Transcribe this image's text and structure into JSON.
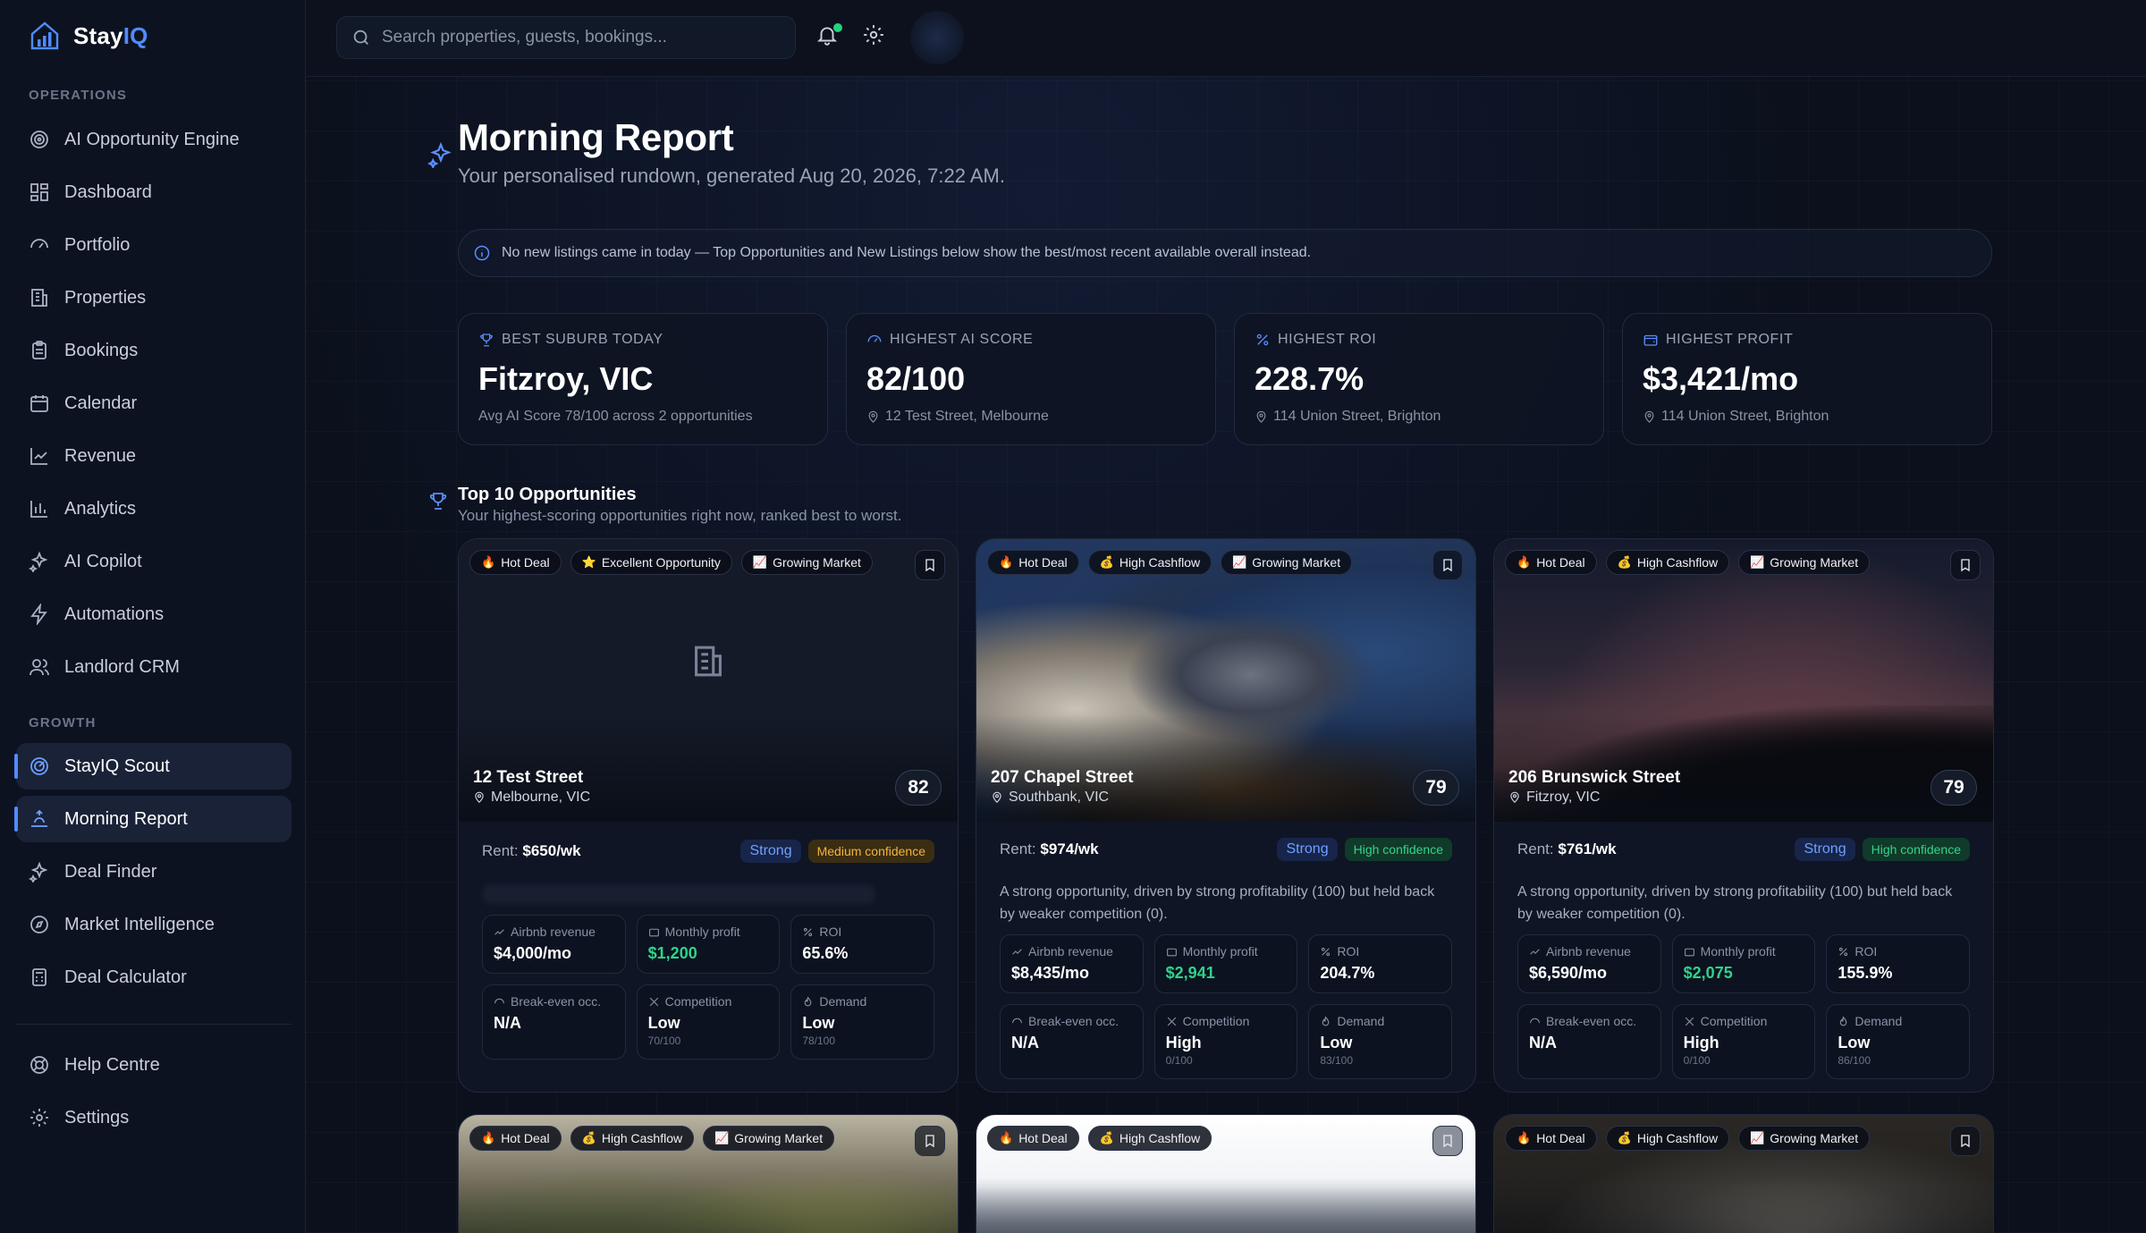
{
  "app": {
    "name_prefix": "Stay",
    "name_suffix": "IQ"
  },
  "sidebar": {
    "operations_label": "OPERATIONS",
    "growth_label": "GROWTH",
    "operations": [
      {
        "label": "AI Opportunity Engine",
        "icon": "target-icon"
      },
      {
        "label": "Dashboard",
        "icon": "grid-icon"
      },
      {
        "label": "Portfolio",
        "icon": "gauge-icon"
      },
      {
        "label": "Properties",
        "icon": "building-icon"
      },
      {
        "label": "Bookings",
        "icon": "clipboard-icon"
      },
      {
        "label": "Calendar",
        "icon": "calendar-icon"
      },
      {
        "label": "Revenue",
        "icon": "trend-icon"
      },
      {
        "label": "Analytics",
        "icon": "bar-chart-icon"
      },
      {
        "label": "AI Copilot",
        "icon": "sparkle-icon"
      },
      {
        "label": "Automations",
        "icon": "bolt-icon"
      },
      {
        "label": "Landlord CRM",
        "icon": "users-icon"
      }
    ],
    "growth": [
      {
        "label": "StayIQ Scout",
        "icon": "scout-icon"
      },
      {
        "label": "Morning Report",
        "icon": "sunrise-icon"
      },
      {
        "label": "Deal Finder",
        "icon": "sparkle-icon"
      },
      {
        "label": "Market Intelligence",
        "icon": "compass-icon"
      },
      {
        "label": "Deal Calculator",
        "icon": "calculator-icon"
      }
    ],
    "footer": [
      {
        "label": "Help Centre",
        "icon": "lifebuoy-icon"
      },
      {
        "label": "Settings",
        "icon": "gear-icon"
      }
    ]
  },
  "topbar": {
    "search_placeholder": "Search properties, guests, bookings..."
  },
  "page": {
    "title": "Morning Report",
    "subtitle": "Your personalised rundown, generated Aug 20, 2026, 7:22 AM.",
    "notice": "No new listings came in today — Top Opportunities and New Listings below show the best/most recent available overall instead."
  },
  "stats": [
    {
      "label": "BEST SUBURB TODAY",
      "value": "Fitzroy, VIC",
      "sub": "Avg AI Score 78/100 across 2 opportunities",
      "icon": "trophy-icon",
      "has_pin": false
    },
    {
      "label": "HIGHEST AI SCORE",
      "value": "82/100",
      "sub": "12 Test Street, Melbourne",
      "icon": "gauge-icon",
      "has_pin": true
    },
    {
      "label": "HIGHEST ROI",
      "value": "228.7%",
      "sub": "114 Union Street, Brighton",
      "icon": "percent-icon",
      "has_pin": true
    },
    {
      "label": "HIGHEST PROFIT",
      "value": "$3,421/mo",
      "sub": "114 Union Street, Brighton",
      "icon": "wallet-icon",
      "has_pin": true
    }
  ],
  "top": {
    "title": "Top 10 Opportunities",
    "subtitle": "Your highest-scoring opportunities right now, ranked best to worst."
  },
  "labels": {
    "rent": "Rent:",
    "airbnb": "Airbnb revenue",
    "profit": "Monthly profit",
    "roi": "ROI",
    "breakeven": "Break-even occ.",
    "competition": "Competition",
    "demand": "Demand"
  },
  "cards": [
    {
      "street": "12 Test Street",
      "city": "Melbourne, VIC",
      "score": "82",
      "chips": [
        "Hot Deal",
        "Excellent Opportunity",
        "Growing Market"
      ],
      "rent": "$650/wk",
      "strength": "Strong",
      "confidence": "Medium confidence",
      "desc": "",
      "airbnb": "$4,000/mo",
      "profit": "$1,200",
      "roi": "65.6%",
      "breakeven": "N/A",
      "competition": "Low",
      "competition_score": "70/100",
      "demand": "Low",
      "demand_score": "78/100"
    },
    {
      "street": "207 Chapel Street",
      "city": "Southbank, VIC",
      "score": "79",
      "chips": [
        "Hot Deal",
        "High Cashflow",
        "Growing Market"
      ],
      "rent": "$974/wk",
      "strength": "Strong",
      "confidence": "High confidence",
      "desc": "A strong opportunity, driven by strong profitability (100) but held back by weaker competition (0).",
      "airbnb": "$8,435/mo",
      "profit": "$2,941",
      "roi": "204.7%",
      "breakeven": "N/A",
      "competition": "High",
      "competition_score": "0/100",
      "demand": "Low",
      "demand_score": "83/100"
    },
    {
      "street": "206 Brunswick Street",
      "city": "Fitzroy, VIC",
      "score": "79",
      "chips": [
        "Hot Deal",
        "High Cashflow",
        "Growing Market"
      ],
      "rent": "$761/wk",
      "strength": "Strong",
      "confidence": "High confidence",
      "desc": "A strong opportunity, driven by strong profitability (100) but held back by weaker competition (0).",
      "airbnb": "$6,590/mo",
      "profit": "$2,075",
      "roi": "155.9%",
      "breakeven": "N/A",
      "competition": "High",
      "competition_score": "0/100",
      "demand": "Low",
      "demand_score": "86/100"
    }
  ],
  "bottom_cards": [
    {
      "chips": [
        "Hot Deal",
        "High Cashflow",
        "Growing Market"
      ]
    },
    {
      "chips": [
        "Hot Deal",
        "High Cashflow"
      ]
    },
    {
      "chips": [
        "Hot Deal",
        "High Cashflow",
        "Growing Market"
      ]
    }
  ]
}
